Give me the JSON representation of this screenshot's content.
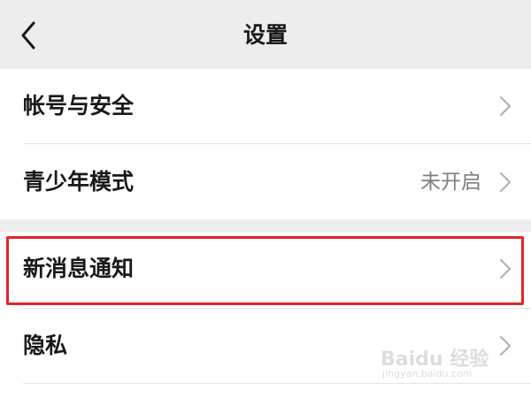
{
  "header": {
    "title": "设置",
    "back_icon": "chevron-left-icon"
  },
  "groups": [
    {
      "items": [
        {
          "label": "帐号与安全",
          "value": "",
          "icon": "chevron-right-icon"
        },
        {
          "label": "青少年模式",
          "value": "未开启",
          "icon": "chevron-right-icon"
        }
      ]
    },
    {
      "items": [
        {
          "label": "新消息通知",
          "value": "",
          "icon": "chevron-right-icon",
          "highlighted": true
        },
        {
          "label": "隐私",
          "value": "",
          "icon": "chevron-right-icon"
        }
      ]
    }
  ],
  "highlight": {
    "color": "#e0262a"
  },
  "watermark": {
    "main": "Baidu 经验",
    "sub": "jingyan.baidu.com"
  },
  "colors": {
    "background": "#ededed",
    "row_background": "#ffffff",
    "text": "#191919",
    "value_text": "#7f7f7f",
    "chevron": "#b2b2b2"
  }
}
